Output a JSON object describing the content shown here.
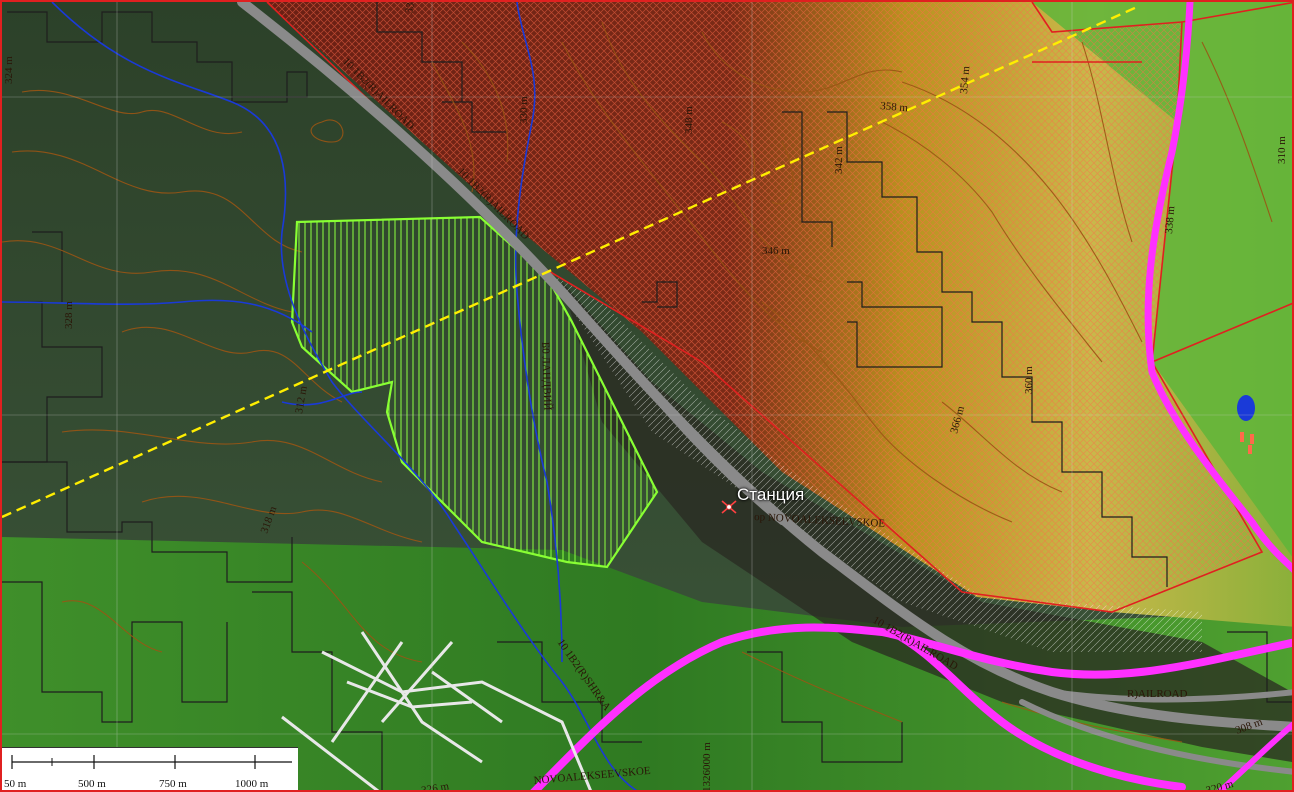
{
  "map": {
    "station_label": "Станция",
    "railroad_labels": [
      "10 1B2(R)AILROAD",
      "10 1B2(R)AILROAD",
      "10 1B2(R)AILROAD",
      "R)AILROAD",
      "10 1B2(R)SHR&A"
    ],
    "station_code_label": "op NOVOALEKSEEVSKOE",
    "settlement_label": "NOVOALEKSEEVSKOE",
    "stream_label": "Б0 ЛАНДВИЙ",
    "grid_label": "1326000 m",
    "contour_labels": [
      "308 m",
      "310 m",
      "312 m",
      "318 m",
      "320 m",
      "324 m",
      "326 m",
      "328 m",
      "330 m",
      "334 m",
      "338 m",
      "342 m",
      "346 m",
      "348 m",
      "354 m",
      "358 m",
      "360 m",
      "366 m"
    ],
    "colors": {
      "boundary": "#e02020",
      "power_line": "#ffee00",
      "road": "#ff30ff",
      "railroad": "#8a8a8a",
      "river": "#1a3ad8",
      "plot_outline": "#88ff33",
      "contour": "#9a5514"
    }
  },
  "scalebar": {
    "labels": [
      "50 m",
      "500 m",
      "750 m",
      "1000 m"
    ]
  }
}
